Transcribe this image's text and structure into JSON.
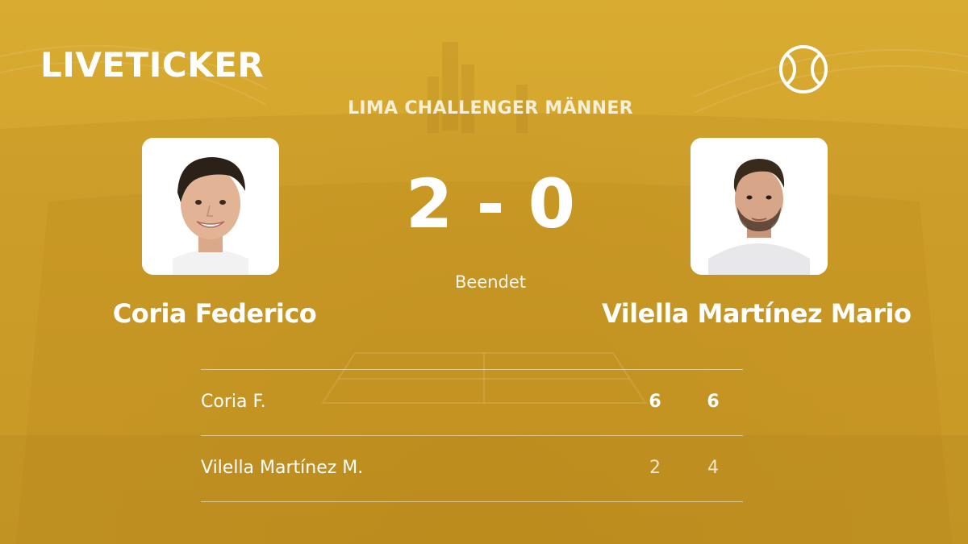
{
  "header": {
    "logo": "LIVETICKER",
    "sport_icon": "tennis-ball-icon"
  },
  "match": {
    "tournament": "LIMA CHALLENGER MÄNNER",
    "score": "2 - 0",
    "status": "Beendet"
  },
  "players": {
    "home": {
      "name": "Coria Federico",
      "photo": "player-photo-coria"
    },
    "away": {
      "name": "Vilella Martínez Mario",
      "photo": "player-photo-vilella"
    }
  },
  "sets": [
    {
      "name": "Coria F.",
      "scores": [
        "6",
        "6"
      ],
      "won": [
        true,
        true
      ]
    },
    {
      "name": "Vilella Martínez M.",
      "scores": [
        "2",
        "4"
      ],
      "won": [
        false,
        false
      ]
    }
  ],
  "colors": {
    "background": "#d4a52c",
    "text": "#ffffff"
  }
}
